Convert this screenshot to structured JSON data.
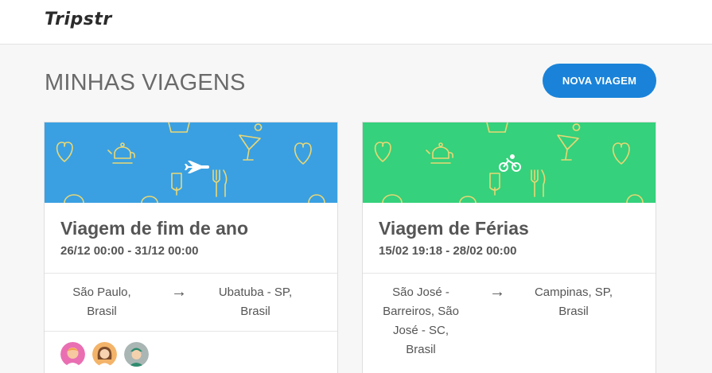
{
  "app": {
    "logo": "Tripstr"
  },
  "header": {
    "title": "MINHAS VIAGENS",
    "new_trip_label": "NOVA VIAGEM"
  },
  "colors": {
    "accent": "#1a83d9",
    "card1_banner": "#3aa0e2",
    "card2_banner": "#35d17c"
  },
  "trips": [
    {
      "title": "Viagem de fim de ano",
      "dates": "26/12 00:00 - 31/12 00:00",
      "transport_icon": "airplane-icon",
      "origin": [
        "São Paulo,",
        "Brasil"
      ],
      "destination": [
        "Ubatuba - SP,",
        "Brasil"
      ],
      "participants": [
        "avatar-pink",
        "avatar-orange",
        "avatar-teal"
      ]
    },
    {
      "title": "Viagem de Férias",
      "dates": "15/02 19:18 - 28/02 00:00",
      "transport_icon": "bicycle-icon",
      "origin": [
        "São José -",
        "Barreiros, São",
        "José - SC,",
        "Brasil"
      ],
      "destination": [
        "Campinas, SP,",
        "Brasil"
      ],
      "participants": []
    }
  ]
}
